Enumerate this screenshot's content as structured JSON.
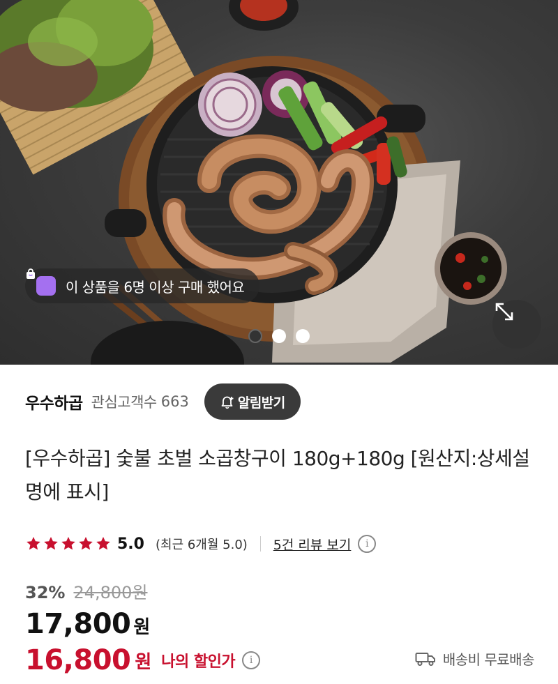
{
  "hero": {
    "buyers_badge": "이 상품을 6명 이상 구매 했어요",
    "slide_count": 3,
    "active_slide": 1
  },
  "seller": {
    "name": "우수하곱",
    "follower_label": "관심고객수",
    "follower_count": "663",
    "notify_label": "알림받기"
  },
  "product": {
    "title": "[우수하곱] 숯불 초벌 소곱창구이 180g+180g [원산지:상세설명에 표시]"
  },
  "rating": {
    "stars": 5,
    "score": "5.0",
    "recent": "(최근 6개월 5.0)",
    "review_link": "5건 리뷰 보기"
  },
  "price": {
    "discount_pct": "32%",
    "original": "24,800원",
    "sale": "17,800",
    "unit": "원",
    "my_price": "16,800",
    "my_unit": "원",
    "my_discount_label": "나의 할인가"
  },
  "shipping": {
    "label": "배송비 무료배송"
  },
  "colors": {
    "accent_red": "#c8102e",
    "star": "#c8102e",
    "badge_purple": "#a470f0"
  }
}
